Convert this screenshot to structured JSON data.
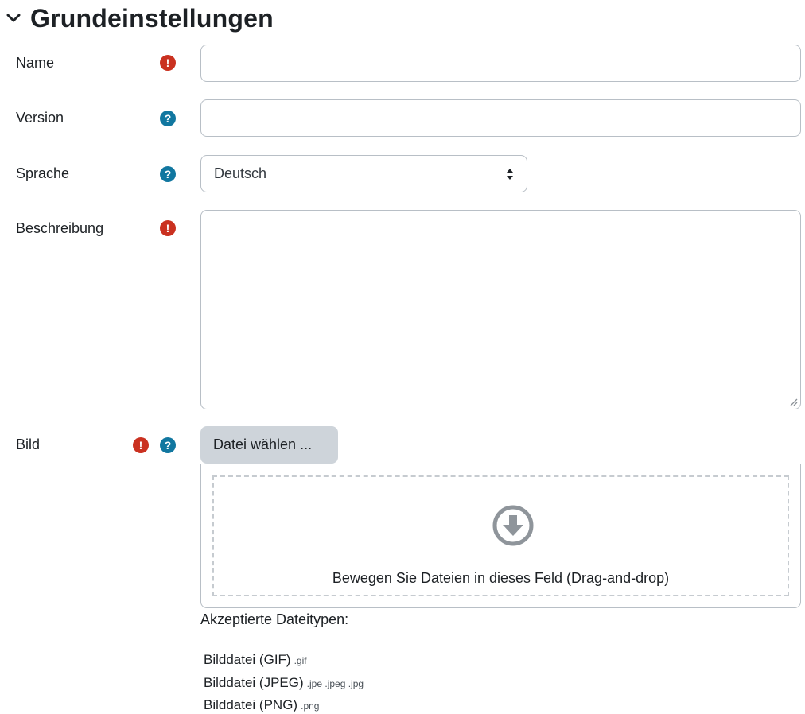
{
  "section": {
    "title": "Grundeinstellungen",
    "icon": "chevron-down-icon"
  },
  "fields": {
    "name": {
      "label": "Name",
      "value": ""
    },
    "version": {
      "label": "Version",
      "value": ""
    },
    "language": {
      "label": "Sprache",
      "selected": "Deutsch"
    },
    "description": {
      "label": "Beschreibung",
      "value": ""
    },
    "image": {
      "label": "Bild",
      "choose_button": "Datei wählen ...",
      "drop_text": "Bewegen Sie Dateien in dieses Feld (Drag-and-drop)"
    }
  },
  "accepted": {
    "heading": "Akzeptierte Dateitypen:",
    "types": [
      {
        "name": "Bilddatei (GIF)",
        "ext": ".gif"
      },
      {
        "name": "Bilddatei (JPEG)",
        "ext": ".jpe .jpeg .jpg"
      },
      {
        "name": "Bilddatei (PNG)",
        "ext": ".png"
      }
    ]
  },
  "colors": {
    "required": "#ca3120",
    "help": "#1177a0",
    "border": "#b8bfc6",
    "button": "#ced4da"
  }
}
